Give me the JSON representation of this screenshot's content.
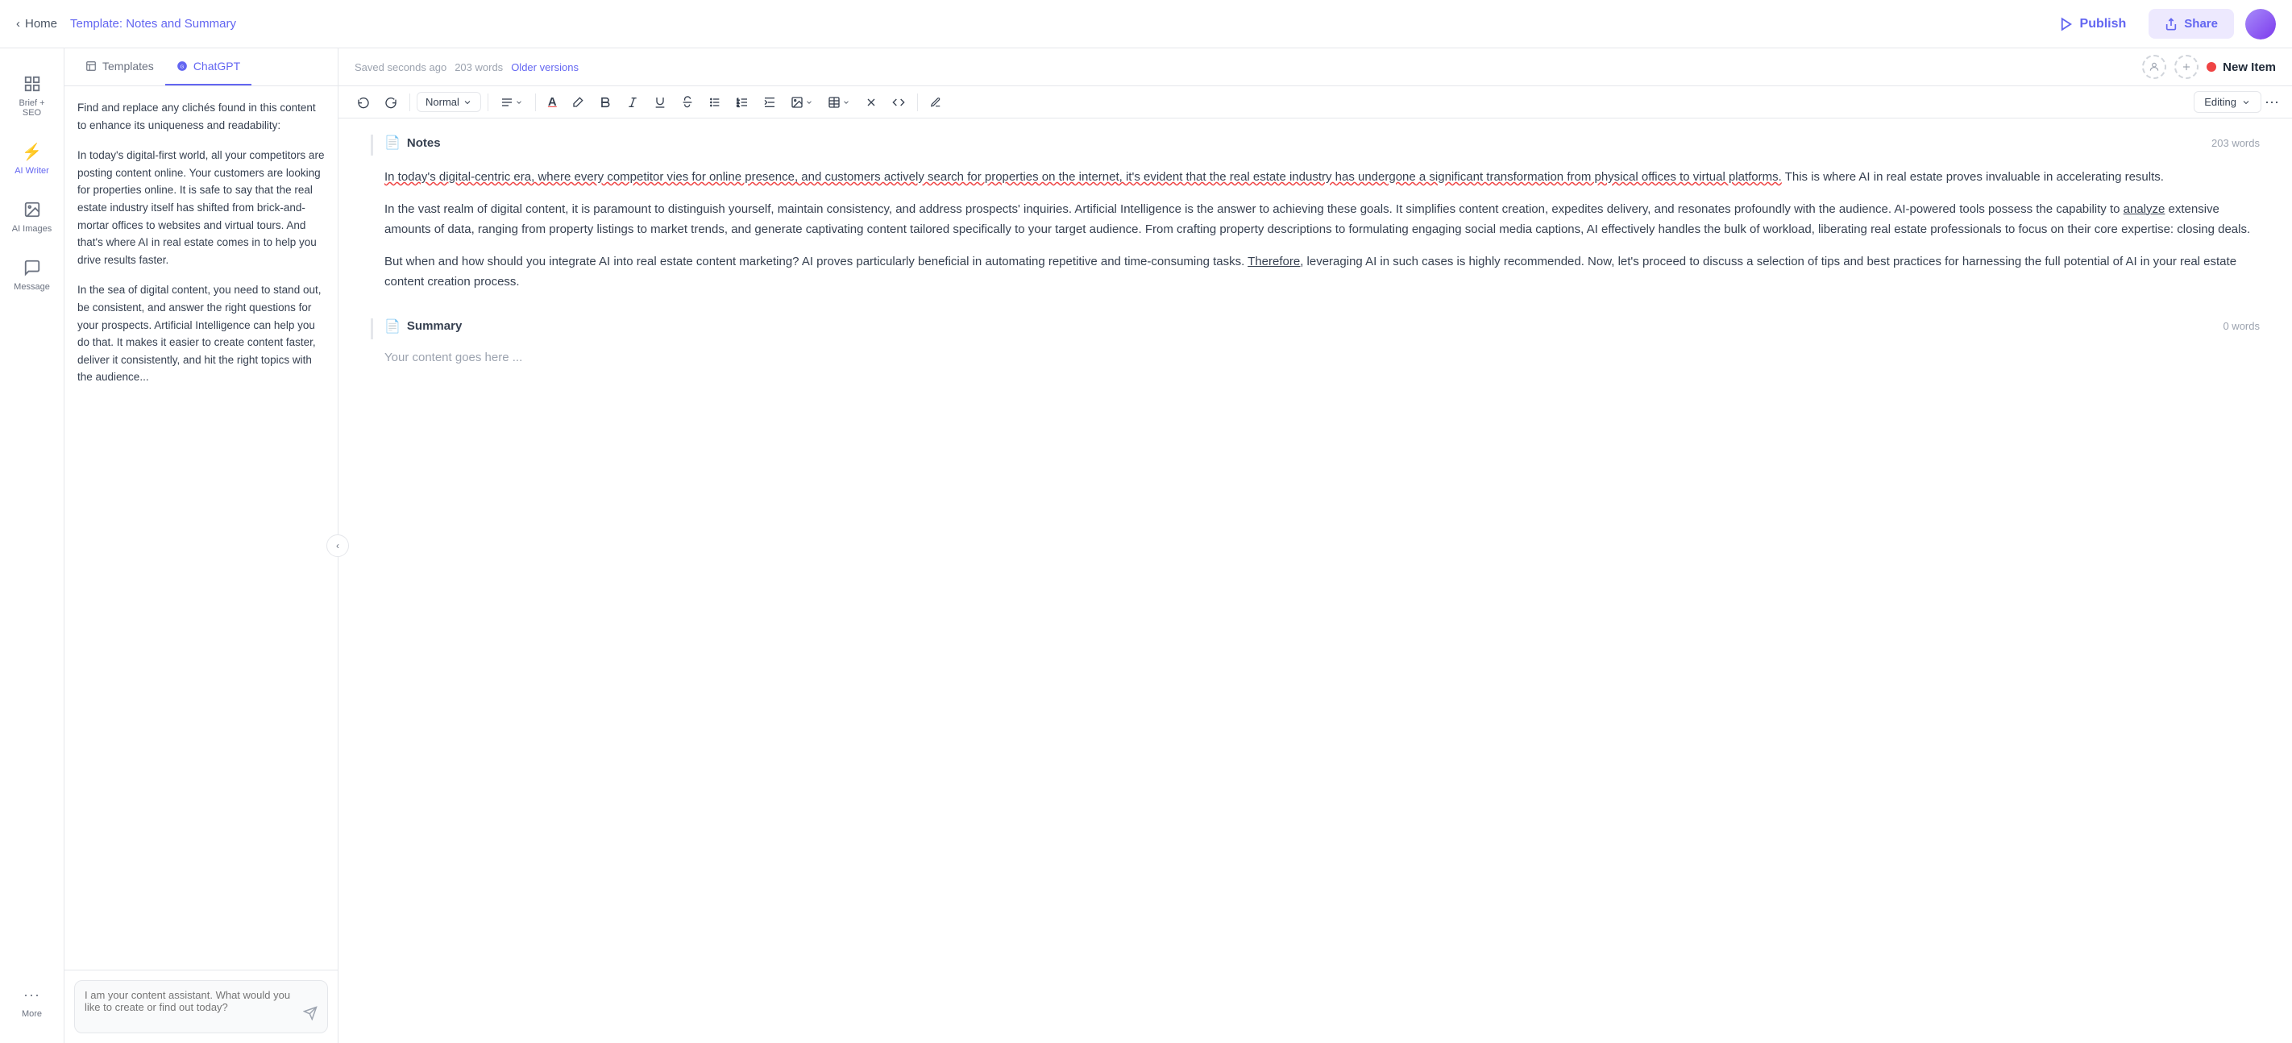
{
  "header": {
    "home_label": "Home",
    "breadcrumb_prefix": "Template: ",
    "breadcrumb_name": "Notes and Summary",
    "publish_label": "Publish",
    "share_label": "Share"
  },
  "left_sidebar": {
    "items": [
      {
        "id": "brief-seo",
        "icon": "⊕",
        "label": "Brief + SEO",
        "active": false
      },
      {
        "id": "ai-writer",
        "icon": "⚡",
        "label": "AI Writer",
        "active": true
      },
      {
        "id": "ai-images",
        "icon": "🖼",
        "label": "AI Images",
        "active": false
      },
      {
        "id": "message",
        "icon": "💬",
        "label": "Message",
        "active": false
      },
      {
        "id": "more",
        "icon": "···",
        "label": "More",
        "active": false
      }
    ]
  },
  "panel": {
    "tabs": [
      {
        "id": "templates",
        "label": "Templates",
        "active": false
      },
      {
        "id": "chatgpt",
        "label": "ChatGPT",
        "active": true
      }
    ],
    "content": [
      "Find and replace any clichés found in this content to enhance its uniqueness and readability:",
      "In today's digital-first world, all your competitors are posting content online. Your customers are looking for properties online. It is safe to say that the real estate industry itself has shifted from brick-and-mortar offices to websites and virtual tours. And that's where AI in real estate comes in to help you drive results faster.",
      "In the sea of digital content, you need to stand out, be consistent, and answer the right questions for your prospects. Artificial Intelligence can help you do that. It makes it easier to create content faster, deliver it consistently, and hit the right topics with the audience..."
    ],
    "chat_placeholder": "I am your content assistant. What would you like to create or find out today?"
  },
  "editor": {
    "saved_text": "Saved seconds ago",
    "word_count": "203 words",
    "older_versions": "Older versions",
    "new_item_label": "New Item",
    "toolbar": {
      "style_label": "Normal",
      "editing_label": "Editing"
    },
    "sections": [
      {
        "id": "notes",
        "title": "Notes",
        "word_count": "203 words",
        "paragraphs": [
          "In today's digital-centric era, where every competitor vies for online presence, and customers actively search for properties on the internet, it's evident that the real estate industry has undergone a significant transformation from physical offices to virtual platforms. This is where AI in real estate proves invaluable in accelerating results.",
          "In the vast realm of digital content, it is paramount to distinguish yourself, maintain consistency, and address prospects' inquiries. Artificial Intelligence is the answer to achieving these goals. It simplifies content creation, expedites delivery, and resonates profoundly with the audience. AI-powered tools possess the capability to analyze extensive amounts of data, ranging from property listings to market trends, and generate captivating content tailored specifically to your target audience. From crafting property descriptions to formulating engaging social media captions, AI effectively handles the bulk of workload, liberating real estate professionals to focus on their core expertise: closing deals.",
          "But when and how should you integrate AI into real estate content marketing? AI proves particularly beneficial in automating repetitive and time-consuming tasks. Therefore, leveraging AI in such cases is highly recommended. Now, let's proceed to discuss a selection of tips and best practices for harnessing the full potential of AI in your real estate content creation process."
        ]
      },
      {
        "id": "summary",
        "title": "Summary",
        "word_count": "0 words",
        "placeholder": "Your content goes here ..."
      }
    ]
  }
}
